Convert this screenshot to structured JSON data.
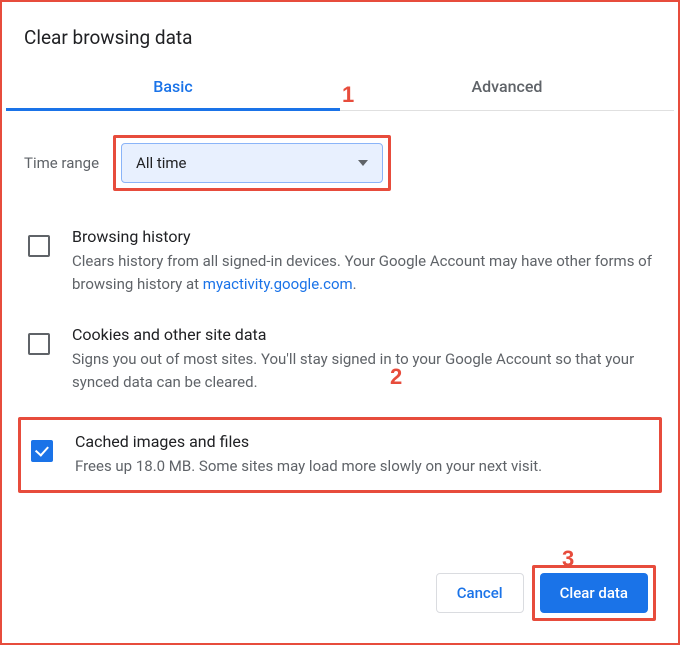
{
  "title": "Clear browsing data",
  "tabs": {
    "basic": "Basic",
    "advanced": "Advanced",
    "active": "basic"
  },
  "timerange": {
    "label": "Time range",
    "value": "All time"
  },
  "options": [
    {
      "title": "Browsing history",
      "desc_pre": "Clears history from all signed-in devices. Your Google Account may have other forms of browsing history at ",
      "link_text": "myactivity.google.com",
      "desc_post": ".",
      "checked": false
    },
    {
      "title": "Cookies and other site data",
      "desc": "Signs you out of most sites. You'll stay signed in to your Google Account so that your synced data can be cleared.",
      "checked": false
    },
    {
      "title": "Cached images and files",
      "desc": "Frees up 18.0 MB. Some sites may load more slowly on your next visit.",
      "checked": true
    }
  ],
  "buttons": {
    "cancel": "Cancel",
    "clear": "Clear data"
  },
  "annotations": {
    "a1": "1",
    "a2": "2",
    "a3": "3"
  },
  "colors": {
    "accent": "#1a73e8",
    "highlight": "#e74c3c"
  }
}
